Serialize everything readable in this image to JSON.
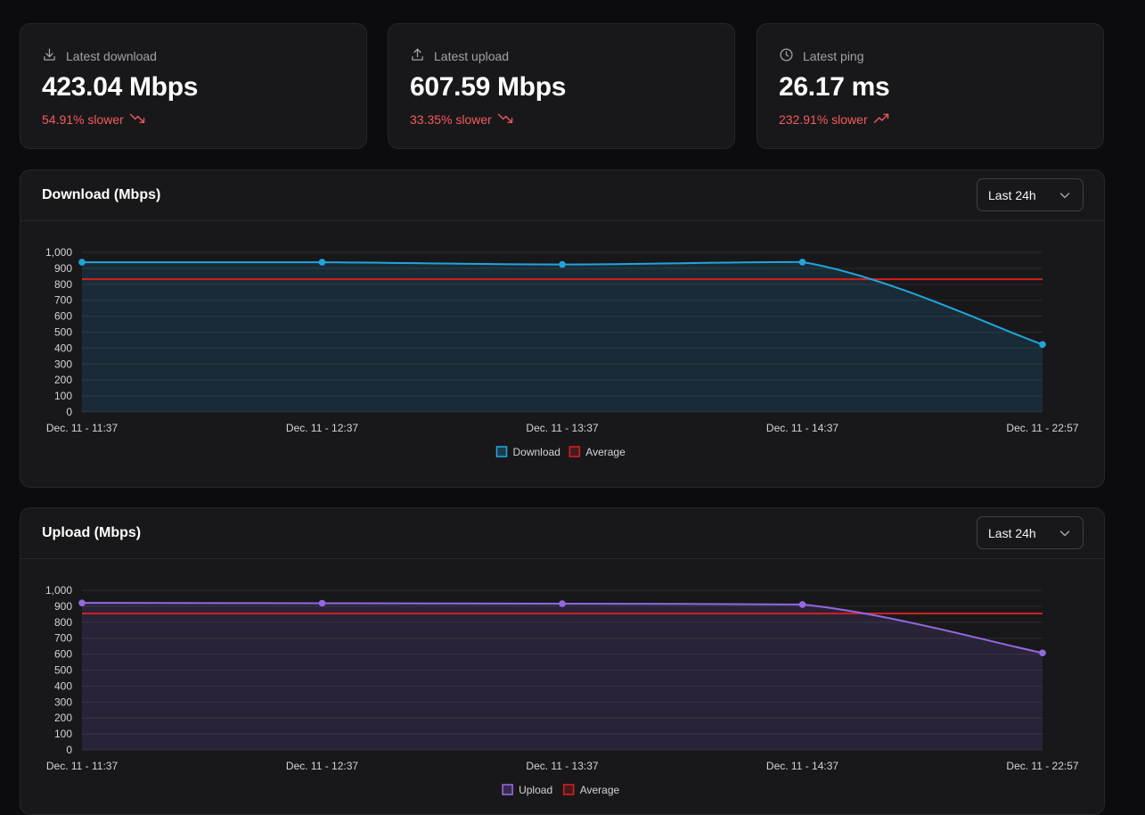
{
  "stats": [
    {
      "label": "Latest download",
      "value": "423.04 Mbps",
      "delta": "54.91% slower",
      "trend": "down",
      "icon": "download-icon"
    },
    {
      "label": "Latest upload",
      "value": "607.59 Mbps",
      "delta": "33.35% slower",
      "trend": "down",
      "icon": "upload-icon"
    },
    {
      "label": "Latest ping",
      "value": "26.17 ms",
      "delta": "232.91% slower",
      "trend": "up",
      "icon": "clock-icon"
    }
  ],
  "colors": {
    "delta_bad": "#f55b5b",
    "download": "#22a4db",
    "upload": "#9468e0",
    "average": "#d11f1f",
    "gridline": "#2c2c31",
    "tick_text": "#d4d4d8"
  },
  "download_panel": {
    "title": "Download (Mbps)",
    "range": "Last 24h"
  },
  "upload_panel": {
    "title": "Upload (Mbps)",
    "range": "Last 24h"
  },
  "chart_data": [
    {
      "type": "line",
      "title": "Download (Mbps)",
      "x": [
        "Dec. 11 - 11:37",
        "Dec. 11 - 12:37",
        "Dec. 11 - 13:37",
        "Dec. 11 - 14:37",
        "Dec. 11 - 22:57"
      ],
      "series": [
        {
          "name": "Download",
          "values": [
            938,
            938,
            924,
            939,
            423.04
          ]
        },
        {
          "name": "Average",
          "values": [
            832,
            832,
            832,
            832,
            832
          ]
        }
      ],
      "ylim": [
        0,
        1000
      ],
      "yticks": [
        "0",
        "100",
        "200",
        "300",
        "400",
        "500",
        "600",
        "700",
        "800",
        "900",
        "1,000"
      ],
      "grid": true,
      "legend": "bottom-center"
    },
    {
      "type": "line",
      "title": "Upload (Mbps)",
      "x": [
        "Dec. 11 - 11:37",
        "Dec. 11 - 12:37",
        "Dec. 11 - 13:37",
        "Dec. 11 - 14:37",
        "Dec. 11 - 22:57"
      ],
      "series": [
        {
          "name": "Upload",
          "values": [
            921,
            919,
            916,
            911,
            607.59
          ]
        },
        {
          "name": "Average",
          "values": [
            855,
            855,
            855,
            855,
            855
          ]
        }
      ],
      "ylim": [
        0,
        1000
      ],
      "yticks": [
        "0",
        "100",
        "200",
        "300",
        "400",
        "500",
        "600",
        "700",
        "800",
        "900",
        "1,000"
      ],
      "grid": true,
      "legend": "bottom-center"
    }
  ]
}
